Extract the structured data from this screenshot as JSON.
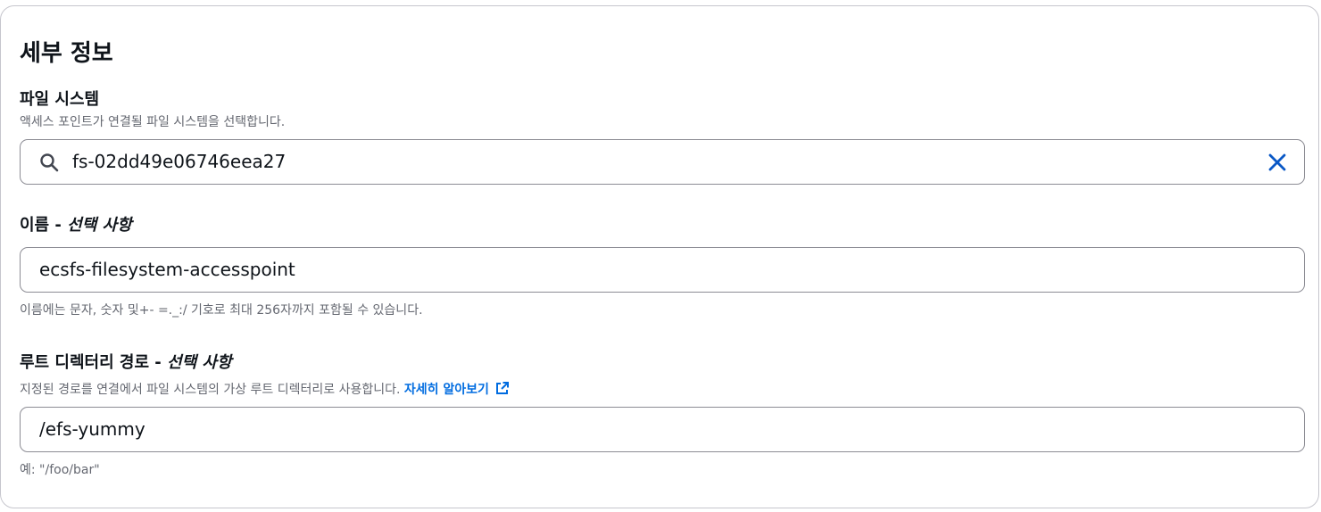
{
  "details": {
    "title": "세부 정보",
    "file_system": {
      "label": "파일 시스템",
      "description": "액세스 포인트가 연결될 파일 시스템을 선택합니다.",
      "value": "fs-02dd49e06746eea27",
      "icons": [
        "search-icon",
        "clear-icon"
      ]
    },
    "name": {
      "label": "이름 -",
      "optional": "선택 사항",
      "value": "ecsfs-filesystem-accesspoint",
      "constraint": "이름에는 문자, 숫자 및+- =._:/ 기호로 최대 256자까지 포함될 수 있습니다."
    },
    "root_directory": {
      "label": "루트 디렉터리 경로 -",
      "optional": "선택 사항",
      "description": "지정된 경로를 연결에서 파일 시스템의 가상 루트 디렉터리로 사용합니다.",
      "learn_more": "자세히 알아보기",
      "value": "/efs-yummy",
      "example": "예: \"/foo/bar\""
    }
  },
  "colors": {
    "text": "#0f141a",
    "secondary_text": "#656871",
    "link": "#006ce0",
    "border": "#8c8c94"
  }
}
